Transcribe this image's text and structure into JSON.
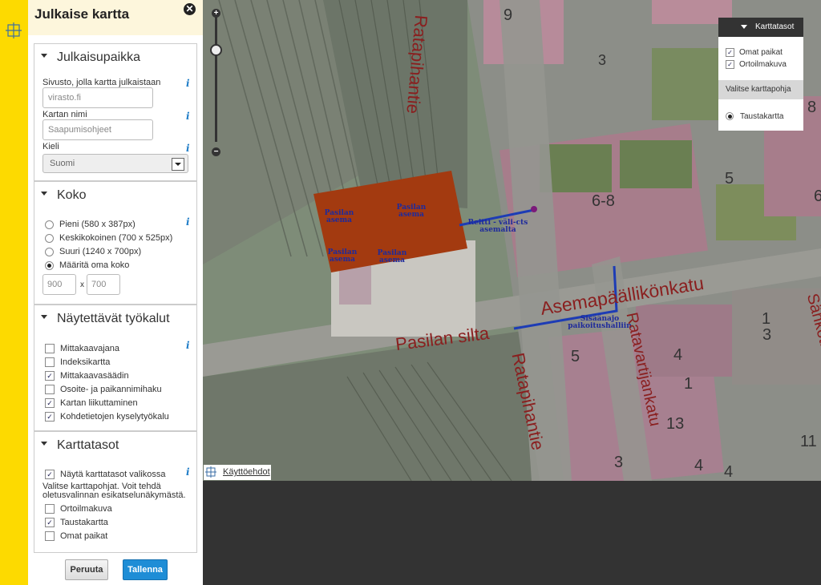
{
  "panel": {
    "title": "Julkaise kartta",
    "sections": {
      "placement": {
        "title": "Julkaisupaikka",
        "site_label": "Sivusto, jolla kartta julkaistaan",
        "site_value": "virasto.fi",
        "name_label": "Kartan nimi",
        "name_value": "Saapumisohjeet",
        "lang_label": "Kieli",
        "lang_value": "Suomi"
      },
      "size": {
        "title": "Koko",
        "options": [
          {
            "label": "Pieni (580 x 387px)",
            "selected": false
          },
          {
            "label": "Keskikokoinen (700 x 525px)",
            "selected": false
          },
          {
            "label": "Suuri (1240 x 700px)",
            "selected": false
          },
          {
            "label": "Määritä oma koko",
            "selected": true
          }
        ],
        "width": "900",
        "height": "700",
        "sep": "x"
      },
      "tools": {
        "title": "Näytettävät työkalut",
        "items": [
          {
            "label": "Mittakaavajana",
            "checked": false
          },
          {
            "label": "Indeksikartta",
            "checked": false
          },
          {
            "label": "Mittakaavasäädin",
            "checked": true
          },
          {
            "label": "Osoite- ja paikannimihaku",
            "checked": false
          },
          {
            "label": "Kartan liikuttaminen",
            "checked": true
          },
          {
            "label": "Kohdetietojen kyselytyökalu",
            "checked": true
          }
        ]
      },
      "layers": {
        "title": "Karttatasot",
        "show_label": "Näytä karttatasot valikossa",
        "show_checked": true,
        "help": "Valitse karttapohjat. Voit tehdä oletusvalinnan esikatselunäkymästä.",
        "items": [
          {
            "label": "Ortoilmakuva",
            "checked": false
          },
          {
            "label": "Taustakartta",
            "checked": true
          },
          {
            "label": "Omat paikat",
            "checked": false
          }
        ]
      }
    },
    "cancel_label": "Peruuta",
    "save_label": "Tallenna"
  },
  "map": {
    "layer_panel": {
      "title": "Karttatasot",
      "layers": [
        {
          "label": "Omat paikat",
          "checked": true
        },
        {
          "label": "Ortoilmakuva",
          "checked": true
        }
      ],
      "base_header": "Valitse karttapohja",
      "base_option": "Taustakartta"
    },
    "terms_label": "Käyttöehdot",
    "pois": [
      {
        "text": "Pasilan asema"
      },
      {
        "text": "Pasilan asema"
      },
      {
        "text": "Pasilan asema"
      },
      {
        "text": "Pasilan asema"
      },
      {
        "text": "Reitti - väli-cts asemalta"
      },
      {
        "text": "Sisäänajo paikoitushalliin"
      }
    ],
    "streets": [
      "Asemapäällikönkatu",
      "Pasilan silta",
      "Ratapihantie",
      "Ratavartijankatu",
      "Ratapihantie",
      "Sähkötie"
    ],
    "numbers": [
      "9",
      "3",
      "5",
      "6-8",
      "5",
      "4",
      "1",
      "13",
      "3",
      "4",
      "4",
      "1",
      "3",
      "11",
      "8",
      "6"
    ]
  },
  "colors": {
    "accent": "#FDDA00",
    "save": "#1E8DD6",
    "area": "#A33A10"
  }
}
